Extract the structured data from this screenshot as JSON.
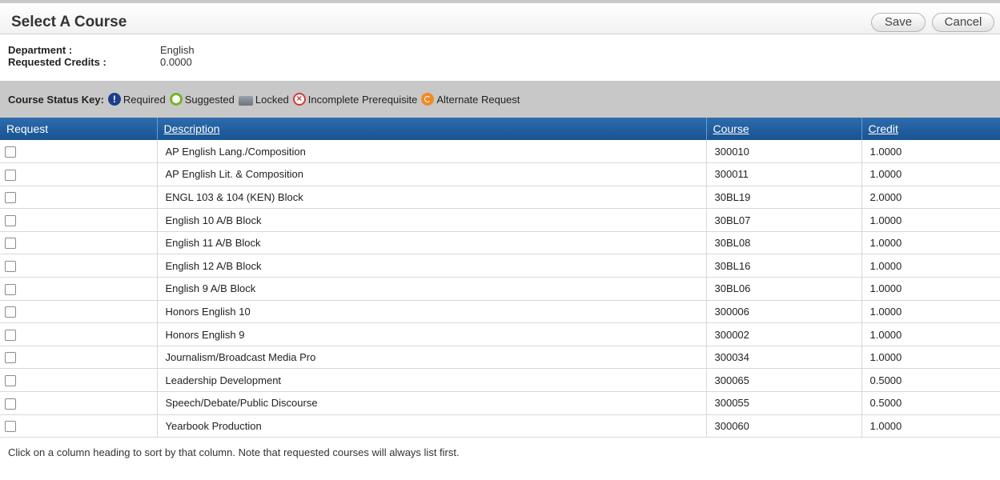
{
  "header": {
    "title": "Select A Course",
    "save_label": "Save",
    "cancel_label": "Cancel"
  },
  "info": {
    "department_label": "Department :",
    "department_value": "English",
    "credits_label": "Requested Credits :",
    "credits_value": "0.0000"
  },
  "status_key": {
    "title": "Course Status Key:",
    "items": [
      {
        "icon": "required-icon",
        "label": "Required"
      },
      {
        "icon": "suggested-icon",
        "label": "Suggested"
      },
      {
        "icon": "locked-icon",
        "label": "Locked"
      },
      {
        "icon": "incomplete-prerequisite-icon",
        "label": "Incomplete Prerequisite"
      },
      {
        "icon": "alternate-request-icon",
        "label": "Alternate Request"
      }
    ]
  },
  "table": {
    "columns": {
      "request": "Request",
      "description": "Description",
      "course": "Course",
      "credit": "Credit"
    },
    "rows": [
      {
        "description": "AP English Lang./Composition",
        "course": "300010",
        "credit": "1.0000"
      },
      {
        "description": "AP English Lit. & Composition",
        "course": "300011",
        "credit": "1.0000"
      },
      {
        "description": "ENGL 103 & 104 (KEN) Block",
        "course": "30BL19",
        "credit": "2.0000"
      },
      {
        "description": "English 10 A/B Block",
        "course": "30BL07",
        "credit": "1.0000"
      },
      {
        "description": "English 11 A/B Block",
        "course": "30BL08",
        "credit": "1.0000"
      },
      {
        "description": "English 12 A/B Block",
        "course": "30BL16",
        "credit": "1.0000"
      },
      {
        "description": "English 9 A/B Block",
        "course": "30BL06",
        "credit": "1.0000"
      },
      {
        "description": "Honors English 10",
        "course": "300006",
        "credit": "1.0000"
      },
      {
        "description": "Honors English 9",
        "course": "300002",
        "credit": "1.0000"
      },
      {
        "description": "Journalism/Broadcast Media Pro",
        "course": "300034",
        "credit": "1.0000"
      },
      {
        "description": "Leadership Development",
        "course": "300065",
        "credit": "0.5000"
      },
      {
        "description": "Speech/Debate/Public Discourse",
        "course": "300055",
        "credit": "0.5000"
      },
      {
        "description": "Yearbook Production",
        "course": "300060",
        "credit": "1.0000"
      }
    ]
  },
  "footnote": "Click on a column heading to sort by that column. Note that requested courses will always list first."
}
